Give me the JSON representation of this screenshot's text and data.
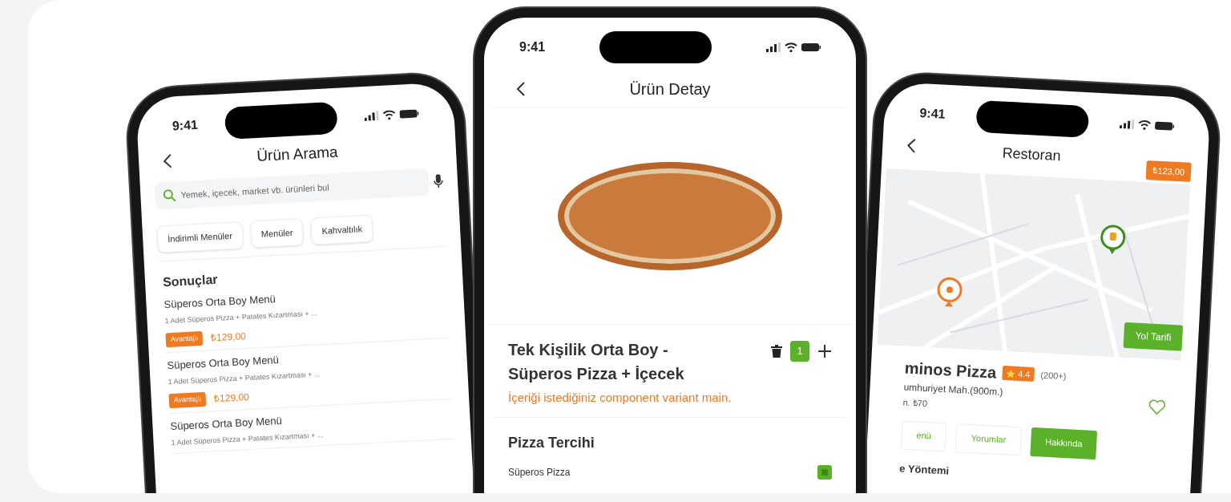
{
  "search_screen": {
    "time": "9:41",
    "title": "Ürün Arama",
    "search": {
      "placeholder": "Yemek, içecek, market vb. ürünleri bul"
    },
    "chips": [
      "İndirimli Menüler",
      "Menüler",
      "Kahvaltılık"
    ],
    "section_title": "Sonuçlar",
    "results": [
      {
        "name": "Süperos Orta Boy Menü",
        "description": "1 Adet Süperos Pizza + Patates Kızartması + ...",
        "badge": "Avantajlı",
        "price": "₺129,00"
      },
      {
        "name": "Süperos Orta Boy Menü",
        "description": "1 Adet Süperos Pizza + Patates Kızartması + ...",
        "badge": "Avantajlı",
        "price": "₺129,00"
      },
      {
        "name": "Süperos Orta Boy Menü",
        "description": "1 Adet Süperos Pizza + Patates Kızartması + ..."
      }
    ]
  },
  "detail_screen": {
    "time": "9:41",
    "title": "Ürün Detay",
    "product_name": "Tek Kişilik Orta Boy - Süperos Pizza + İçecek",
    "quantity": "1",
    "description": "İçeriği istediğiniz component variant main.",
    "section_title": "Pizza Tercihi",
    "options": [
      {
        "label": "Süperos Pizza",
        "checked": true
      }
    ]
  },
  "restaurant_screen": {
    "time": "9:41",
    "title": "Restoran",
    "cart_total": "₺123,00",
    "map_button": "Yol Tarifi",
    "name": "minos Pizza",
    "rating": "4.4",
    "review_count": "(200+)",
    "address": "umhuriyet Mah.(900m.)",
    "min_order": "n. ₺70",
    "favorite": false,
    "tabs": [
      {
        "label": "enü",
        "selected": false
      },
      {
        "label": "Yorumlar",
        "selected": false
      },
      {
        "label": "Hakkında",
        "selected": true
      }
    ],
    "section_title": "e Yöntemi"
  }
}
